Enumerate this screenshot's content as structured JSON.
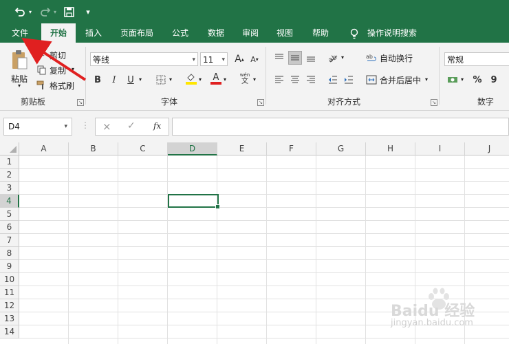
{
  "colors": {
    "brand": "#217346",
    "ribbon_bg": "#f3f3f3",
    "annotation_arrow": "#e02020",
    "font_color_bar": "#e02020",
    "fill_color_bar": "#ffe600"
  },
  "qat": {
    "undo_icon": "undo-icon",
    "redo_icon": "redo-icon",
    "save_icon": "save-icon",
    "customize_icon": "customize-qat-icon"
  },
  "tabs": [
    {
      "label": "文件"
    },
    {
      "label": "开始"
    },
    {
      "label": "插入"
    },
    {
      "label": "页面布局"
    },
    {
      "label": "公式"
    },
    {
      "label": "数据"
    },
    {
      "label": "审阅"
    },
    {
      "label": "视图"
    },
    {
      "label": "帮助"
    }
  ],
  "tell_me": {
    "label": "操作说明搜索"
  },
  "clipboard": {
    "paste_label": "粘贴",
    "cut_label": "剪切",
    "copy_label": "复制",
    "format_painter_label": "格式刷",
    "group_label": "剪贴板"
  },
  "font": {
    "font_name": "等线",
    "font_size": "11",
    "grow_label": "A",
    "shrink_label": "A",
    "bold_label": "B",
    "italic_label": "I",
    "underline_label": "U",
    "font_color_label": "A",
    "phonetic_top": "wén",
    "phonetic_bottom": "文",
    "group_label": "字体"
  },
  "alignment": {
    "wrap_label": "自动换行",
    "merge_label": "合并后居中",
    "group_label": "对齐方式"
  },
  "number": {
    "format_value": "常规",
    "percent_label": "%",
    "comma_label": "9",
    "group_label": "数字"
  },
  "formula_bar": {
    "name_box_value": "D4",
    "cancel_icon": "×",
    "enter_icon": "✓",
    "fx_label": "fx",
    "formula_value": ""
  },
  "grid": {
    "columns": [
      "A",
      "B",
      "C",
      "D",
      "E",
      "F",
      "G",
      "H",
      "I",
      "J"
    ],
    "rows": [
      "1",
      "2",
      "3",
      "4",
      "5",
      "6",
      "7",
      "8",
      "9",
      "10",
      "11",
      "12",
      "13",
      "14"
    ],
    "active_cell": "D4"
  },
  "watermark": {
    "main": "Baidu 经验",
    "sub": "jingyan.baidu.com"
  }
}
